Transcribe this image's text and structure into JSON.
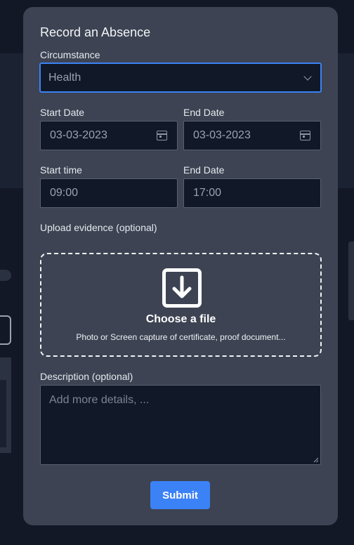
{
  "modal": {
    "title": "Record an Absence",
    "circumstance": {
      "label": "Circumstance",
      "value": "Health",
      "icon": "chevron-down-icon"
    },
    "start_date": {
      "label": "Start Date",
      "value": "03-03-2023",
      "icon": "calendar-icon"
    },
    "end_date": {
      "label": "End Date",
      "value": "03-03-2023",
      "icon": "calendar-icon"
    },
    "start_time": {
      "label": "Start time",
      "value": "09:00"
    },
    "end_time": {
      "label": "End Date",
      "value": "17:00"
    },
    "upload": {
      "label": "Upload evidence (optional)",
      "title": "Choose a file",
      "hint": "Photo or Screen capture of certificate, proof document...",
      "icon": "download-icon"
    },
    "description": {
      "label": "Description (optional)",
      "placeholder": "Add more details, ..."
    },
    "submit_label": "Submit"
  },
  "colors": {
    "accent": "#3b82f6",
    "modal_bg": "#3d4352",
    "field_bg": "#111827",
    "page_bg": "#121826"
  }
}
